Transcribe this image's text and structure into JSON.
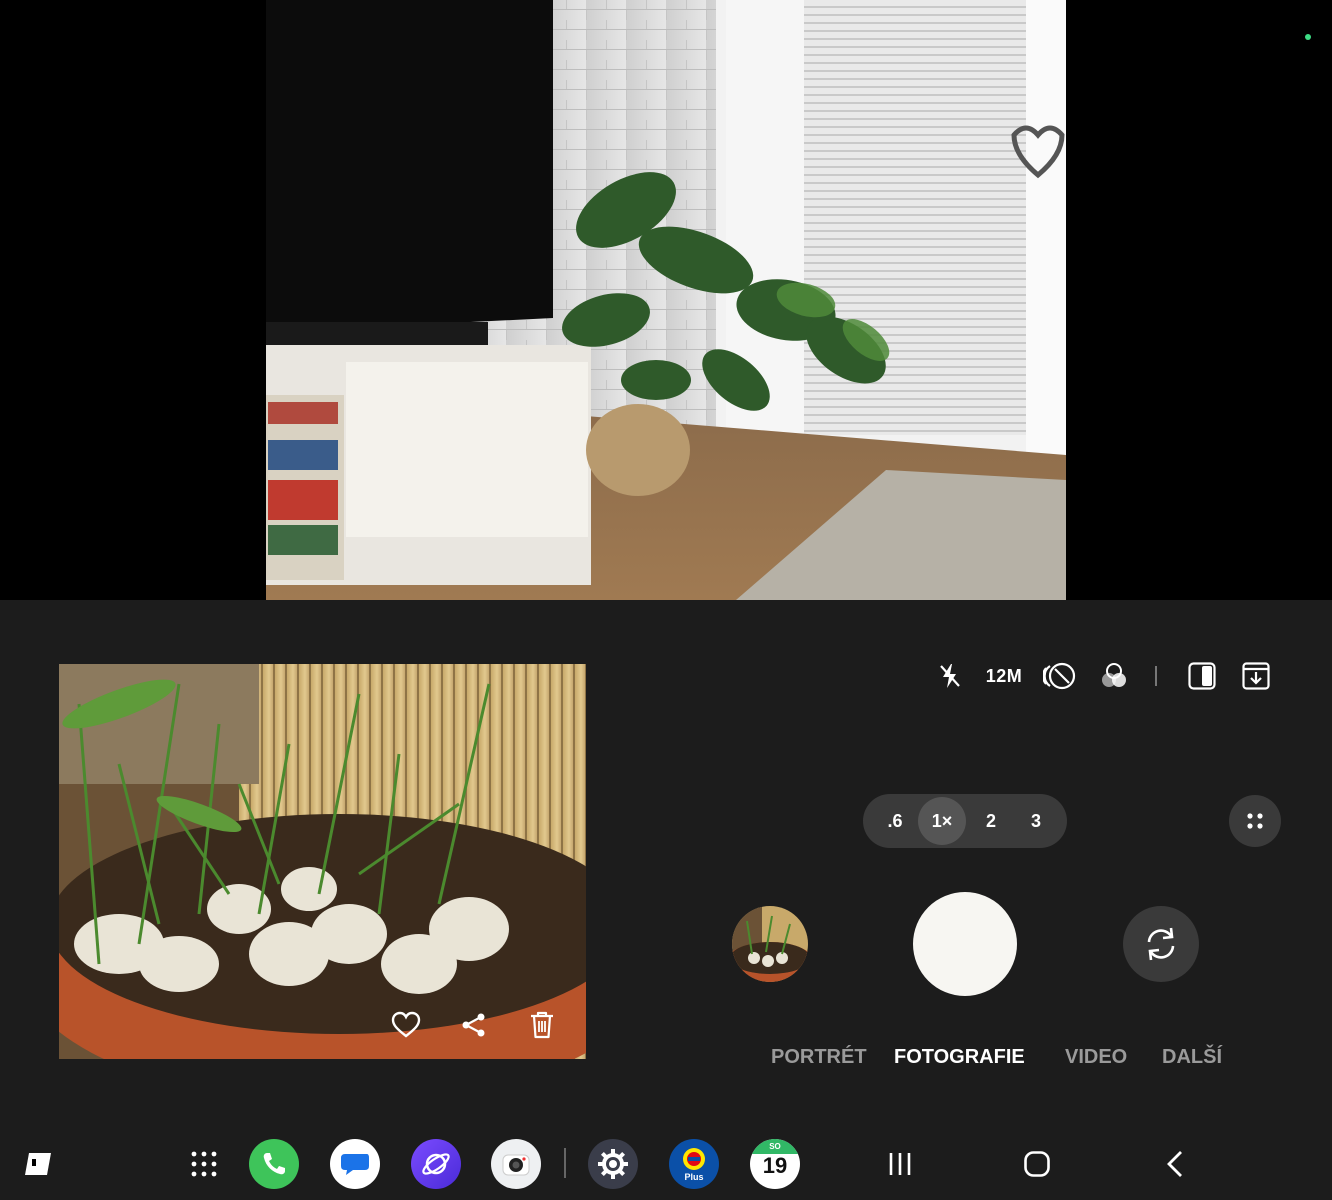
{
  "camera": {
    "settings": {
      "flash_icon": "flash-off-icon",
      "resolution": "12M"
    },
    "zoom": {
      "options": [
        ".6",
        "1×",
        "2",
        "3"
      ],
      "active": "1×"
    },
    "modes": {
      "items": [
        "PORTRÉT",
        "FOTOGRAFIE",
        "VIDEO",
        "DALŠÍ"
      ],
      "active": "FOTOGRAFIE"
    }
  },
  "taskbar": {
    "apps": [
      "phone",
      "messages",
      "internet",
      "camera",
      "settings",
      "lidl-plus",
      "calendar"
    ],
    "lidl_label": "Plus",
    "calendar": {
      "day_abbr": "SO",
      "date": "19"
    }
  },
  "colors": {
    "panel_bg": "#1c1c1c",
    "control_bg": "#3a3a3a",
    "active_mode": "#ffffff",
    "inactive_mode": "#9a9a9a",
    "privacy_dot": "#3ddc84"
  }
}
